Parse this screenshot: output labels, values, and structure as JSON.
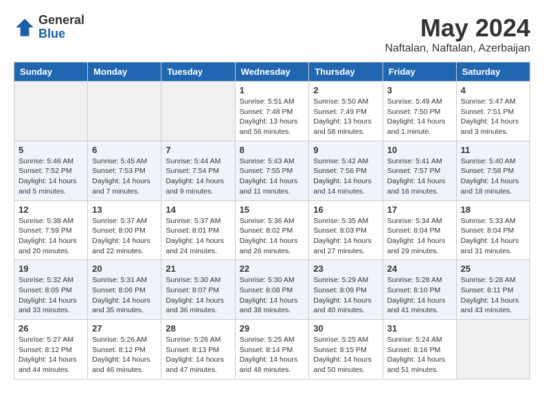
{
  "logo": {
    "general": "General",
    "blue": "Blue"
  },
  "title": {
    "month": "May 2024",
    "location": "Naftalan, Naftalan, Azerbaijan"
  },
  "weekdays": [
    "Sunday",
    "Monday",
    "Tuesday",
    "Wednesday",
    "Thursday",
    "Friday",
    "Saturday"
  ],
  "weeks": [
    [
      {
        "day": "",
        "sunrise": "",
        "sunset": "",
        "daylight": ""
      },
      {
        "day": "",
        "sunrise": "",
        "sunset": "",
        "daylight": ""
      },
      {
        "day": "",
        "sunrise": "",
        "sunset": "",
        "daylight": ""
      },
      {
        "day": "1",
        "sunrise": "Sunrise: 5:51 AM",
        "sunset": "Sunset: 7:48 PM",
        "daylight": "Daylight: 13 hours and 56 minutes."
      },
      {
        "day": "2",
        "sunrise": "Sunrise: 5:50 AM",
        "sunset": "Sunset: 7:49 PM",
        "daylight": "Daylight: 13 hours and 58 minutes."
      },
      {
        "day": "3",
        "sunrise": "Sunrise: 5:49 AM",
        "sunset": "Sunset: 7:50 PM",
        "daylight": "Daylight: 14 hours and 1 minute."
      },
      {
        "day": "4",
        "sunrise": "Sunrise: 5:47 AM",
        "sunset": "Sunset: 7:51 PM",
        "daylight": "Daylight: 14 hours and 3 minutes."
      }
    ],
    [
      {
        "day": "5",
        "sunrise": "Sunrise: 5:46 AM",
        "sunset": "Sunset: 7:52 PM",
        "daylight": "Daylight: 14 hours and 5 minutes."
      },
      {
        "day": "6",
        "sunrise": "Sunrise: 5:45 AM",
        "sunset": "Sunset: 7:53 PM",
        "daylight": "Daylight: 14 hours and 7 minutes."
      },
      {
        "day": "7",
        "sunrise": "Sunrise: 5:44 AM",
        "sunset": "Sunset: 7:54 PM",
        "daylight": "Daylight: 14 hours and 9 minutes."
      },
      {
        "day": "8",
        "sunrise": "Sunrise: 5:43 AM",
        "sunset": "Sunset: 7:55 PM",
        "daylight": "Daylight: 14 hours and 11 minutes."
      },
      {
        "day": "9",
        "sunrise": "Sunrise: 5:42 AM",
        "sunset": "Sunset: 7:56 PM",
        "daylight": "Daylight: 14 hours and 14 minutes."
      },
      {
        "day": "10",
        "sunrise": "Sunrise: 5:41 AM",
        "sunset": "Sunset: 7:57 PM",
        "daylight": "Daylight: 14 hours and 16 minutes."
      },
      {
        "day": "11",
        "sunrise": "Sunrise: 5:40 AM",
        "sunset": "Sunset: 7:58 PM",
        "daylight": "Daylight: 14 hours and 18 minutes."
      }
    ],
    [
      {
        "day": "12",
        "sunrise": "Sunrise: 5:38 AM",
        "sunset": "Sunset: 7:59 PM",
        "daylight": "Daylight: 14 hours and 20 minutes."
      },
      {
        "day": "13",
        "sunrise": "Sunrise: 5:37 AM",
        "sunset": "Sunset: 8:00 PM",
        "daylight": "Daylight: 14 hours and 22 minutes."
      },
      {
        "day": "14",
        "sunrise": "Sunrise: 5:37 AM",
        "sunset": "Sunset: 8:01 PM",
        "daylight": "Daylight: 14 hours and 24 minutes."
      },
      {
        "day": "15",
        "sunrise": "Sunrise: 5:36 AM",
        "sunset": "Sunset: 8:02 PM",
        "daylight": "Daylight: 14 hours and 26 minutes."
      },
      {
        "day": "16",
        "sunrise": "Sunrise: 5:35 AM",
        "sunset": "Sunset: 8:03 PM",
        "daylight": "Daylight: 14 hours and 27 minutes."
      },
      {
        "day": "17",
        "sunrise": "Sunrise: 5:34 AM",
        "sunset": "Sunset: 8:04 PM",
        "daylight": "Daylight: 14 hours and 29 minutes."
      },
      {
        "day": "18",
        "sunrise": "Sunrise: 5:33 AM",
        "sunset": "Sunset: 8:04 PM",
        "daylight": "Daylight: 14 hours and 31 minutes."
      }
    ],
    [
      {
        "day": "19",
        "sunrise": "Sunrise: 5:32 AM",
        "sunset": "Sunset: 8:05 PM",
        "daylight": "Daylight: 14 hours and 33 minutes."
      },
      {
        "day": "20",
        "sunrise": "Sunrise: 5:31 AM",
        "sunset": "Sunset: 8:06 PM",
        "daylight": "Daylight: 14 hours and 35 minutes."
      },
      {
        "day": "21",
        "sunrise": "Sunrise: 5:30 AM",
        "sunset": "Sunset: 8:07 PM",
        "daylight": "Daylight: 14 hours and 36 minutes."
      },
      {
        "day": "22",
        "sunrise": "Sunrise: 5:30 AM",
        "sunset": "Sunset: 8:08 PM",
        "daylight": "Daylight: 14 hours and 38 minutes."
      },
      {
        "day": "23",
        "sunrise": "Sunrise: 5:29 AM",
        "sunset": "Sunset: 8:09 PM",
        "daylight": "Daylight: 14 hours and 40 minutes."
      },
      {
        "day": "24",
        "sunrise": "Sunrise: 5:28 AM",
        "sunset": "Sunset: 8:10 PM",
        "daylight": "Daylight: 14 hours and 41 minutes."
      },
      {
        "day": "25",
        "sunrise": "Sunrise: 5:28 AM",
        "sunset": "Sunset: 8:11 PM",
        "daylight": "Daylight: 14 hours and 43 minutes."
      }
    ],
    [
      {
        "day": "26",
        "sunrise": "Sunrise: 5:27 AM",
        "sunset": "Sunset: 8:12 PM",
        "daylight": "Daylight: 14 hours and 44 minutes."
      },
      {
        "day": "27",
        "sunrise": "Sunrise: 5:26 AM",
        "sunset": "Sunset: 8:12 PM",
        "daylight": "Daylight: 14 hours and 46 minutes."
      },
      {
        "day": "28",
        "sunrise": "Sunrise: 5:26 AM",
        "sunset": "Sunset: 8:13 PM",
        "daylight": "Daylight: 14 hours and 47 minutes."
      },
      {
        "day": "29",
        "sunrise": "Sunrise: 5:25 AM",
        "sunset": "Sunset: 8:14 PM",
        "daylight": "Daylight: 14 hours and 48 minutes."
      },
      {
        "day": "30",
        "sunrise": "Sunrise: 5:25 AM",
        "sunset": "Sunset: 8:15 PM",
        "daylight": "Daylight: 14 hours and 50 minutes."
      },
      {
        "day": "31",
        "sunrise": "Sunrise: 5:24 AM",
        "sunset": "Sunset: 8:16 PM",
        "daylight": "Daylight: 14 hours and 51 minutes."
      },
      {
        "day": "",
        "sunrise": "",
        "sunset": "",
        "daylight": ""
      }
    ]
  ]
}
